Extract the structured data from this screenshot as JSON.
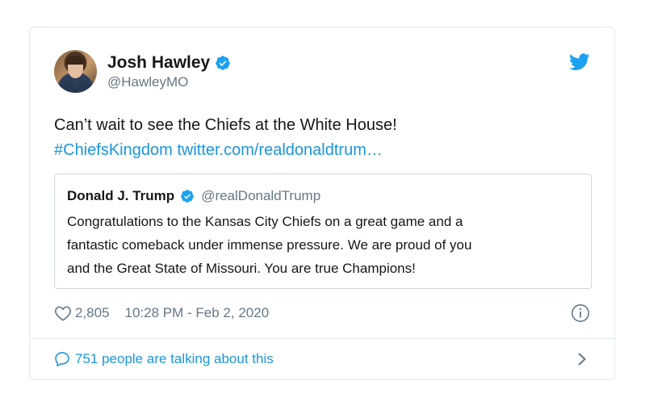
{
  "author": {
    "display_name": "Josh Hawley",
    "handle": "@HawleyMO",
    "verified": true
  },
  "tweet": {
    "text": "Can’t wait to see the Chiefs at the White House!",
    "hashtag": "#ChiefsKingdom",
    "link": "twitter.com/realdonaldtrum…"
  },
  "quoted_tweet": {
    "display_name": "Donald J. Trump",
    "handle": "@realDonaldTrump",
    "verified": true,
    "lines": [
      "Congratulations to the Kansas City Chiefs on a great game and a",
      "fantastic comeback under immense pressure. We are proud of you",
      "and the Great State of Missouri. You are true Champions!"
    ]
  },
  "meta": {
    "likes": "2,805",
    "timestamp": "10:28 PM - Feb 2, 2020"
  },
  "footer": {
    "talking_text": "751 people are talking about this"
  },
  "icons": {
    "brand": "twitter-bird-icon",
    "verified": "verified-badge-icon",
    "like": "heart-icon",
    "info": "info-icon",
    "reply": "speech-bubble-icon",
    "more": "chevron-right-icon"
  },
  "colors": {
    "link": "#1b95e0",
    "secondary_text": "#657786",
    "border": "#e1e8ed",
    "verified": "#1da1f2"
  }
}
